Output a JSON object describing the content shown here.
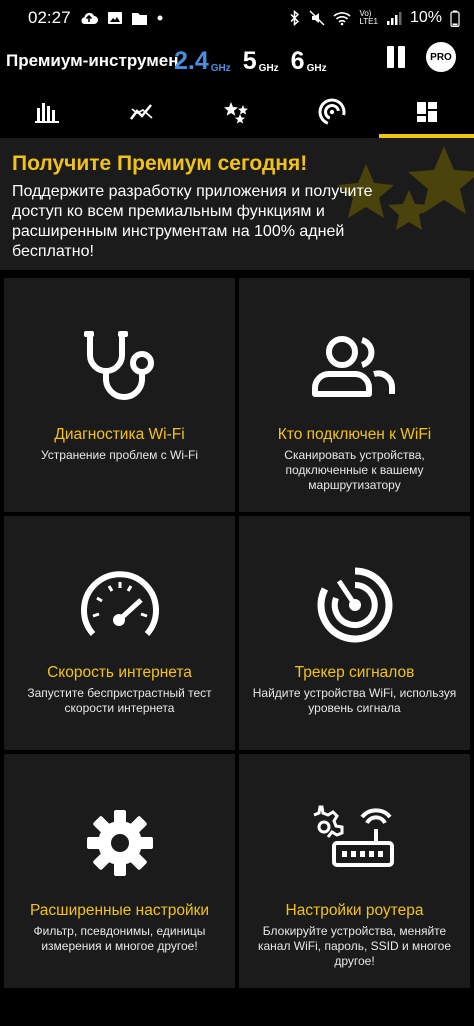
{
  "status": {
    "time": "02:27",
    "volte_top": "Vo)",
    "volte_bottom": "LTE1",
    "battery": "10%"
  },
  "app_bar": {
    "title": "Премиум-инструменты",
    "bands": [
      {
        "num": "2.4",
        "unit": "GHz",
        "active": true
      },
      {
        "num": "5",
        "unit": "GHz",
        "active": false
      },
      {
        "num": "6",
        "unit": "GHz",
        "active": false
      }
    ],
    "pro_label": "PRO"
  },
  "tabs": [
    {
      "icon": "bar-chart-icon"
    },
    {
      "icon": "line-graph-icon"
    },
    {
      "icon": "stars-icon"
    },
    {
      "icon": "wifi-signal-icon"
    },
    {
      "icon": "grid-tiles-icon",
      "active": true
    }
  ],
  "promo": {
    "title": "Получите Премиум сегодня!",
    "text": "Поддержите разработку приложения и получите доступ ко всем премиальным функциям и расширенным инструментам на 100% адней бесплатно!"
  },
  "cards": [
    {
      "icon": "stethoscope-icon",
      "title": "Диагностика Wi-Fi",
      "desc": "Устранение проблем с Wi-Fi"
    },
    {
      "icon": "users-icon",
      "title": "Кто подключен к WiFi",
      "desc": "Сканировать устройства, подключенные к вашему маршрутизатору"
    },
    {
      "icon": "speedometer-icon",
      "title": "Скорость интернета",
      "desc": "Запустите беспристрастный тест скорости интернета"
    },
    {
      "icon": "radar-icon",
      "title": "Трекер сигналов",
      "desc": "Найдите устройства WiFi, используя уровень сигнала"
    },
    {
      "icon": "gear-icon",
      "title": "Расширенные настройки",
      "desc": "Фильтр, псевдонимы, единицы измерения и многое другое!"
    },
    {
      "icon": "router-settings-icon",
      "title": "Настройки роутера",
      "desc": "Блокируйте устройства, меняйте канал WiFi, пароль, SSID и многое другое!"
    }
  ],
  "colors": {
    "accent": "#f2c316",
    "band_active": "#4a8fe0",
    "card_bg": "#1b1b1b"
  }
}
